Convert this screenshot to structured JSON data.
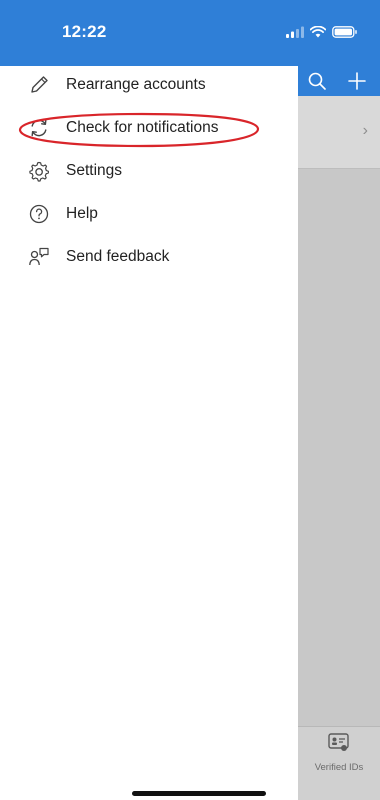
{
  "status_bar": {
    "time": "12:22",
    "icons": [
      "cellular-signal-icon",
      "wifi-icon",
      "battery-icon"
    ]
  },
  "header": {
    "actions": [
      "search-icon",
      "add-icon"
    ]
  },
  "menu": {
    "items": [
      {
        "label": "Rearrange accounts",
        "icon": "pencil-icon"
      },
      {
        "label": "Check for notifications",
        "icon": "refresh-icon",
        "highlighted": true
      },
      {
        "label": "Settings",
        "icon": "gear-icon"
      },
      {
        "label": "Help",
        "icon": "help-icon"
      },
      {
        "label": "Send feedback",
        "icon": "feedback-icon"
      }
    ]
  },
  "bottom_tab": {
    "label": "Verified IDs",
    "icon": "id-card-icon"
  },
  "colors": {
    "accent": "#2f7fd7",
    "highlight_circle": "#d9252a",
    "drawer_bg": "#ffffff",
    "overlay_bg": "#c8c8c8"
  }
}
